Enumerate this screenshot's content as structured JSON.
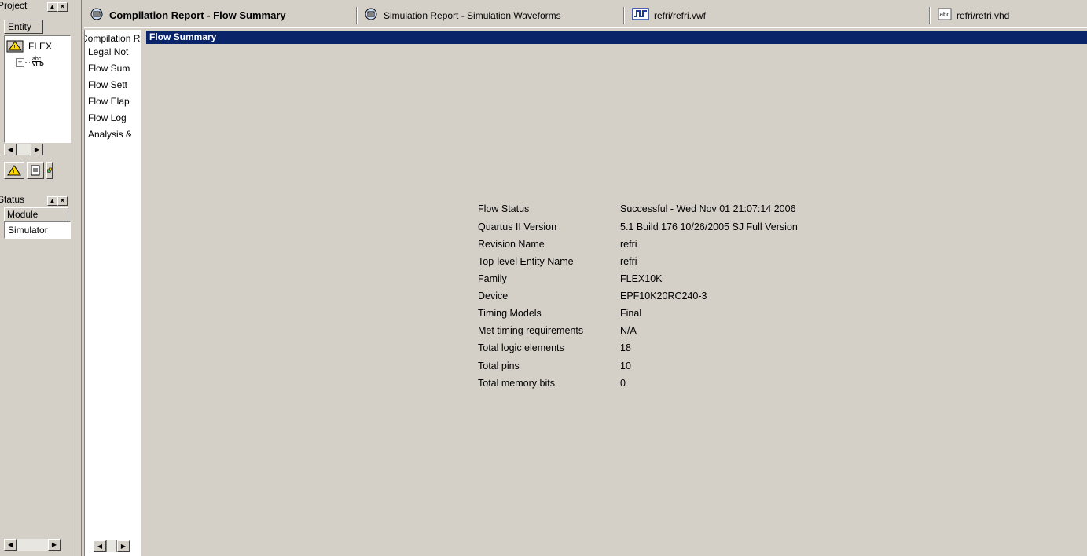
{
  "project_panel": {
    "title": "Project",
    "column_header": "Entity",
    "entity_item": "FLEX",
    "file_badge_top": "abc",
    "file_badge_bottom": "VHD"
  },
  "status_panel": {
    "title": "Status",
    "column_header": "Module",
    "item": "Simulator"
  },
  "tabs": [
    {
      "label": "Compilation Report - Flow Summary",
      "active": true
    },
    {
      "label": "Simulation Report - Simulation Waveforms",
      "active": false
    },
    {
      "label": "refri/refri.vwf",
      "active": false
    },
    {
      "label": "refri/refri.vhd",
      "active": false
    }
  ],
  "report_tree": {
    "items": [
      "Compilation R",
      "Legal Not",
      "Flow Sum",
      "Flow Sett",
      "Flow Elap",
      "Flow Log",
      "Analysis &"
    ]
  },
  "report": {
    "header": "Flow Summary",
    "rows": [
      {
        "key": "Flow Status",
        "value": "Successful - Wed Nov 01 21:07:14 2006"
      },
      {
        "key": "Quartus II Version",
        "value": "5.1 Build 176 10/26/2005 SJ Full Version"
      },
      {
        "key": "Revision Name",
        "value": "refri"
      },
      {
        "key": "Top-level Entity Name",
        "value": "refri"
      },
      {
        "key": "Family",
        "value": "FLEX10K"
      },
      {
        "key": "Device",
        "value": "EPF10K20RC240-3"
      },
      {
        "key": "Timing Models",
        "value": "Final"
      },
      {
        "key": "Met timing requirements",
        "value": "N/A"
      },
      {
        "key": "Total logic elements",
        "value": "18"
      },
      {
        "key": "Total pins",
        "value": "10"
      },
      {
        "key": "Total memory bits",
        "value": "0"
      }
    ]
  },
  "colors": {
    "header_bg": "#0a246a",
    "window_bg": "#d4d0c8"
  }
}
